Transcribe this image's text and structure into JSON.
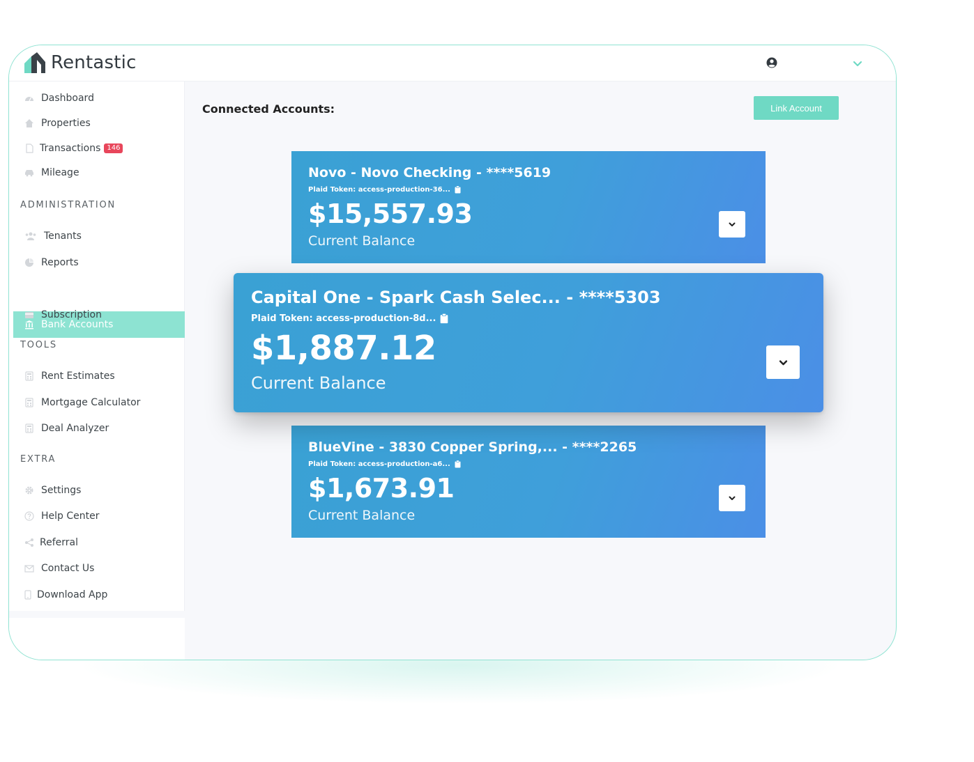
{
  "app": {
    "name": "Rentastic"
  },
  "sidebar": {
    "main": [
      {
        "label": "Dashboard",
        "icon": "dashboard-icon"
      },
      {
        "label": "Properties",
        "icon": "home-icon"
      },
      {
        "label": "Transactions",
        "icon": "document-icon",
        "badge": "146"
      },
      {
        "label": "Mileage",
        "icon": "car-icon"
      }
    ],
    "administration_label": "ADMINISTRATION",
    "administration": [
      {
        "label": "Tenants",
        "icon": "users-icon"
      },
      {
        "label": "Reports",
        "icon": "pie-chart-icon"
      },
      {
        "label": "Bank Accounts",
        "icon": "bank-icon",
        "active": true
      },
      {
        "label": "Subscription",
        "icon": "card-icon"
      }
    ],
    "tools_label": "TOOLS",
    "tools": [
      {
        "label": "Rent Estimates",
        "icon": "calculator-icon"
      },
      {
        "label": "Mortgage Calculator",
        "icon": "calculator-icon"
      },
      {
        "label": "Deal Analyzer",
        "icon": "calculator-icon"
      }
    ],
    "extra_label": "EXTRA",
    "extra": [
      {
        "label": "Settings",
        "icon": "gear-icon"
      },
      {
        "label": "Help Center",
        "icon": "question-icon"
      },
      {
        "label": "Referral",
        "icon": "share-icon"
      },
      {
        "label": "Contact Us",
        "icon": "envelope-icon"
      },
      {
        "label": "Download App",
        "icon": "phone-icon"
      }
    ]
  },
  "main": {
    "title": "Connected Accounts:",
    "link_button": "Link Account",
    "accounts": [
      {
        "title": "Novo - Novo Checking - ****5619",
        "token": "Plaid Token: access-production-36...",
        "balance": "$15,557.93",
        "balance_label": "Current Balance"
      },
      {
        "title": "Capital One - Spark Cash Selec... - ****5303",
        "token": "Plaid Token: access-production-8d...",
        "balance": "$1,887.12",
        "balance_label": "Current Balance"
      },
      {
        "title": "BlueVine - 3830 Copper Spring,... - ****2265",
        "token": "Plaid Token: access-production-a6...",
        "balance": "$1,673.91",
        "balance_label": "Current Balance"
      }
    ]
  },
  "colors": {
    "accent": "#6fd9c4",
    "active_nav": "#8de3d2",
    "card_start": "#3aa1d4",
    "card_end": "#4b8fe6",
    "badge": "#e8465b"
  }
}
